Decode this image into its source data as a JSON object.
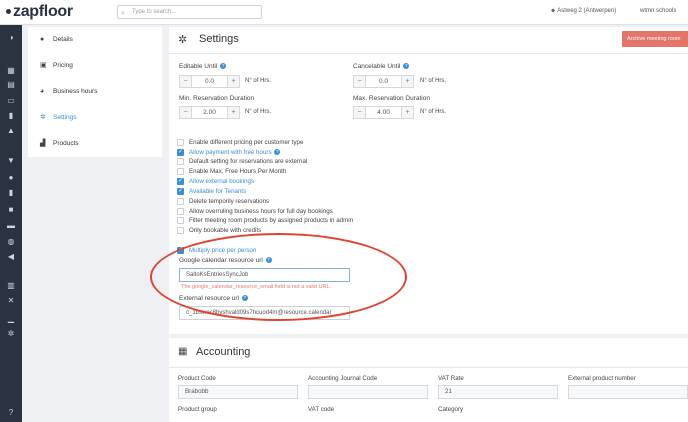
{
  "app": {
    "logo": "zapfloor",
    "search_placeholder": "Type to search...",
    "location": "Astweg 2 (Antwerpen)",
    "workspace": "wtmn schools"
  },
  "subnav": {
    "items": [
      {
        "label": "Details",
        "icon": "info-icon"
      },
      {
        "label": "Pricing",
        "icon": "pricing-icon"
      },
      {
        "label": "Business hours",
        "icon": "clock-icon"
      },
      {
        "label": "Settings",
        "icon": "gear-icon",
        "active": true
      },
      {
        "label": "Products",
        "icon": "cart-icon"
      }
    ]
  },
  "settings": {
    "title": "Settings",
    "archive_button": "Archive meeting room",
    "editable_until": {
      "label": "Editable Until",
      "value": "0.0",
      "unit": "N° of Hrs."
    },
    "cancelable_until": {
      "label": "Cancelable Until",
      "value": "0.0",
      "unit": "N° of Hrs."
    },
    "min_duration": {
      "label": "Min. Reservation Duration",
      "value": "2.00",
      "unit": "N° of Hrs."
    },
    "max_duration": {
      "label": "Max. Reservation Duration",
      "value": "4.00",
      "unit": "N° of Hrs."
    },
    "checkboxes": [
      {
        "label": "Enable different pricing per customer type",
        "checked": false
      },
      {
        "label": "Allow payment with free hours",
        "checked": true
      },
      {
        "label": "Default setting for reservations are external",
        "checked": false
      },
      {
        "label": "Enable Max. Free Hours Per Month",
        "checked": false
      },
      {
        "label": "Allow external bookings",
        "checked": true
      },
      {
        "label": "Available for Tenants",
        "checked": true
      },
      {
        "label": "Delete temporily reservations",
        "checked": false
      },
      {
        "label": "Allow overruling business hours for full day bookings",
        "checked": false
      },
      {
        "label": "Filter meeting room products by assigned products in admin",
        "checked": false
      },
      {
        "label": "Only bookable with credits",
        "checked": false
      }
    ],
    "multiply_price": {
      "label": "Multiply price per person",
      "checked": true
    },
    "google_calendar": {
      "label": "Google calendar resource url",
      "value": "SaltoKsEntriesSyncJob",
      "error": "The google_calendar_resource_email field is not a valid URL."
    },
    "external_resource": {
      "label": "External resource url",
      "value": "c_1bswoc8byshvald09s7hcuod4m@resource.calendar"
    }
  },
  "accounting": {
    "title": "Accounting",
    "fields": [
      {
        "label": "Product Code",
        "value": "Brabobb"
      },
      {
        "label": "Accounting Journal Code",
        "value": ""
      },
      {
        "label": "VAT Rate",
        "value": "21"
      },
      {
        "label": "External product number",
        "value": ""
      }
    ],
    "fields2": [
      {
        "label": "Product group"
      },
      {
        "label": "VAT code"
      },
      {
        "label": "Category"
      }
    ]
  },
  "colors": {
    "accent": "#3a8fd6",
    "rail": "#2b3340",
    "archive": "#e4756a",
    "annotation": "#e0442f"
  }
}
